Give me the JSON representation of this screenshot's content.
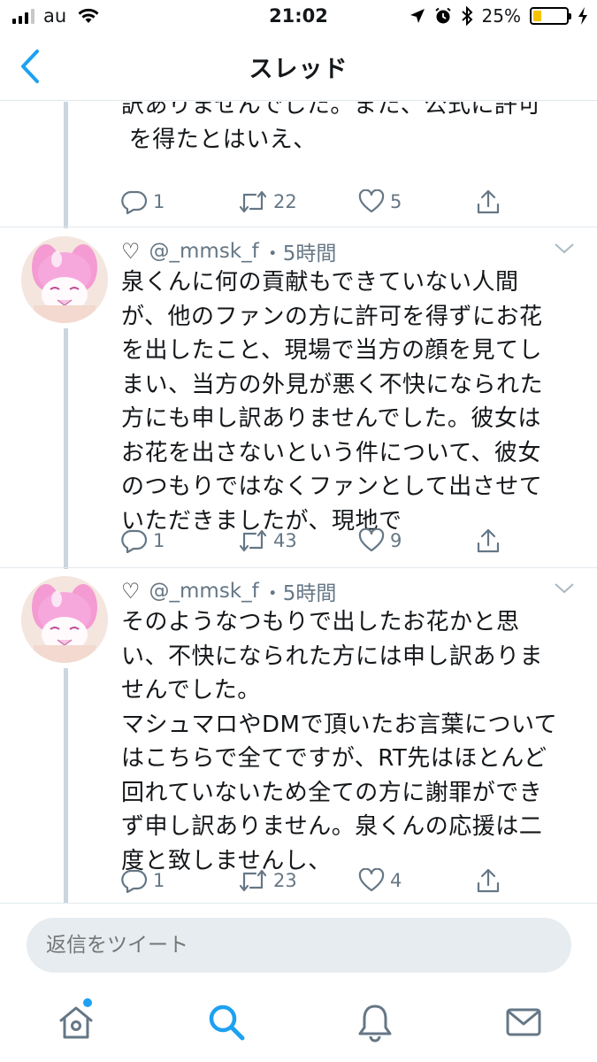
{
  "status_bar": {
    "carrier": "au",
    "time": "21:02",
    "battery_percent": "25%",
    "battery_level": 0.25,
    "icons": [
      "signal-icon",
      "wifi-icon",
      "location-icon",
      "alarm-icon",
      "bluetooth-icon",
      "battery-icon",
      "charging-icon"
    ]
  },
  "nav": {
    "title": "スレッド",
    "back_icon": "chevron-left-icon"
  },
  "thread": {
    "partial_tweet": {
      "text": "訳ありませんでした。また、公式に許可\n得たとはいえ、",
      "text_full": "訳ありませんでした。また、公式に許可\n を得たとはいえ、",
      "replies": "1",
      "retweets": "22",
      "likes": "5"
    },
    "tweets": [
      {
        "handle_prefix": "♡",
        "handle": "@_mmsk_f",
        "time": "・5時間",
        "text": "泉くんに何の貢献もできていない人間\nが、他のファンの方に許可を得ずにお花\nを出したこと、現場で当方の顔を見てし\nまい、当方の外見が悪く不快になられた\n方にも申し訳ありませんでした。彼女は\nお花を出さないという件について、彼女\nのつもりではなくファンとして出させて\nいただきましたが、現地で",
        "replies": "1",
        "retweets": "43",
        "likes": "9"
      },
      {
        "handle_prefix": "♡",
        "handle": "@_mmsk_f",
        "time": "・5時間",
        "text": "そのようなつもりで出したお花かと思\nい、不快になられた方には申し訳ありま\nせんでした。\nマシュマロやDMで頂いたお言葉について\nはこちらで全てですが、RT先はほとんど\n回れていないため全ての方に謝罪ができ\nず申し訳ありません。泉くんの応援は二\n度と致しませんし、",
        "replies": "1",
        "retweets": "23",
        "likes": "4"
      }
    ]
  },
  "reply": {
    "placeholder": "返信をツイート"
  },
  "tabs": [
    {
      "name": "home",
      "icon": "home-icon"
    },
    {
      "name": "search",
      "icon": "search-icon",
      "active": true
    },
    {
      "name": "notifications",
      "icon": "bell-icon"
    },
    {
      "name": "messages",
      "icon": "envelope-icon"
    }
  ],
  "colors": {
    "accent": "#1da1f2",
    "text": "#14171a",
    "secondary": "#657786",
    "thread_line": "#ccd6dd",
    "battery": "#f5c400"
  }
}
